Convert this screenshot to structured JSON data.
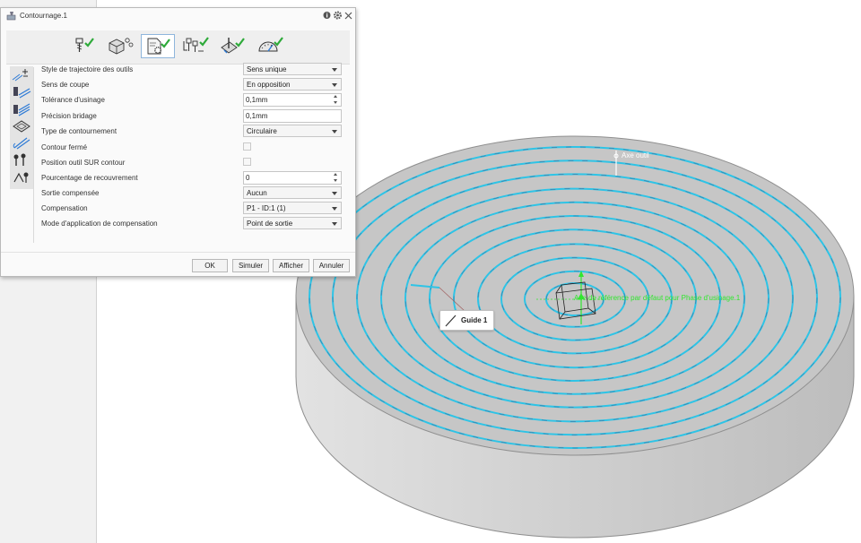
{
  "dialog": {
    "title": "Contournage.1",
    "info_icon": "info-icon",
    "settings_icon": "gear-icon",
    "close_icon": "close-icon",
    "tabs": [
      {
        "name": "tool-tab",
        "icon": "tool-icon",
        "checked": true
      },
      {
        "name": "geometry-tab",
        "icon": "part-geometry-icon",
        "checked": false
      },
      {
        "name": "strategy-tab",
        "icon": "strategy-icon",
        "checked": true
      },
      {
        "name": "macros-tab",
        "icon": "macros-icon",
        "checked": true
      },
      {
        "name": "feeds-tab",
        "icon": "feeds-icon",
        "checked": true
      },
      {
        "name": "speed-tab",
        "icon": "speed-gauge-icon",
        "checked": true
      }
    ],
    "fields": [
      {
        "label": "Style de trajectoire des outils",
        "type": "select",
        "value": "Sens unique"
      },
      {
        "label": "Sens de coupe",
        "type": "select",
        "value": "En opposition"
      },
      {
        "label": "Tolérance d'usinage",
        "type": "spin",
        "value": "0,1mm"
      },
      {
        "label": "Précision bridage",
        "type": "text",
        "value": "0,1mm"
      },
      {
        "label": "Type de contournement",
        "type": "select",
        "value": "Circulaire"
      },
      {
        "label": "Contour fermé",
        "type": "checkbox",
        "checked": false
      },
      {
        "label": "Position outil SUR contour",
        "type": "checkbox",
        "checked": false
      },
      {
        "label": "Pourcentage de recouvrement",
        "type": "spin",
        "value": "0"
      },
      {
        "label": "Sortie compensée",
        "type": "select",
        "value": "Aucun"
      },
      {
        "label": "Compensation",
        "type": "select",
        "value": "P1 - ID:1 (1)"
      },
      {
        "label": "Mode d'application de compensation",
        "type": "select",
        "value": "Point de sortie"
      }
    ],
    "buttons": {
      "ok": "OK",
      "simulate": "Simuler",
      "display": "Afficher",
      "cancel": "Annuler"
    }
  },
  "viewport": {
    "guide_label": "Guide 1",
    "tool_axis_label": "Axe outil",
    "reference_label": "Axe de référence par défaut pour Phase d'usinage.1"
  },
  "colors": {
    "toolpath": "#2ec4e6",
    "check": "#2eaa3a",
    "reference": "#31e62f",
    "part_top": "#c3c3c3",
    "part_side": "#d7d7d7",
    "tab_active_border": "#8fb6dc"
  }
}
